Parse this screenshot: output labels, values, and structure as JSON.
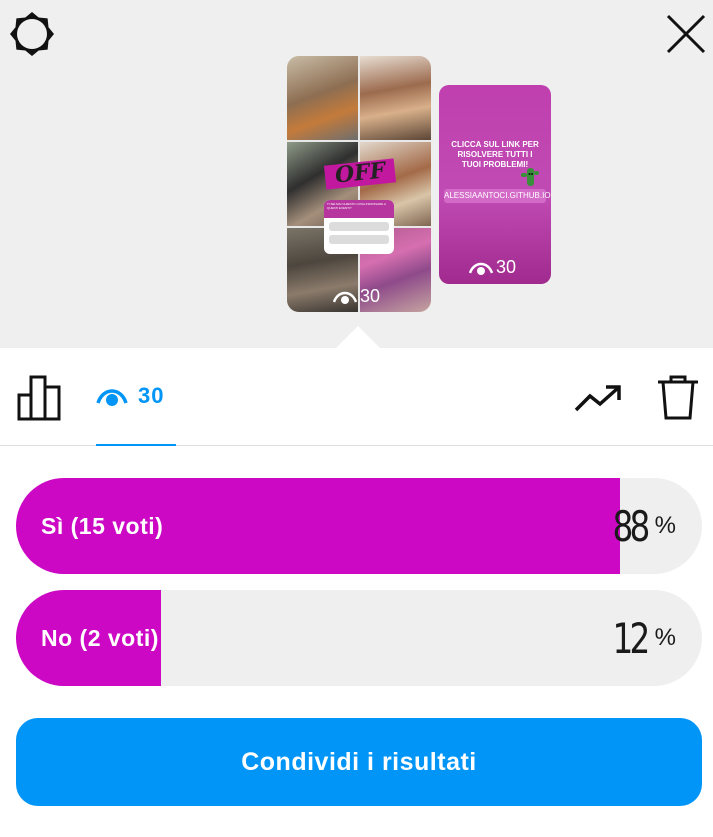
{
  "header": {
    "settings_icon": "settings-icon",
    "close_icon": "close-icon"
  },
  "stories": {
    "current": {
      "views": "30",
      "sticker_text": "OFF",
      "poll_sticker_question": "TI SEI MAI CHIESTO COSA INDOSSARE A QUESTI EVENTI?"
    },
    "next": {
      "text": "CLICCA SUL LINK PER RISOLVERE TUTTI I TUOI PROBLEMI!",
      "link": "ALESSIAANTOCI.GITHUB.IO",
      "views": "30"
    }
  },
  "tabs": {
    "views_count": "30",
    "active": "views"
  },
  "poll": {
    "options": [
      {
        "label": "Sì (15 voti)",
        "percent_num": "88",
        "percent_sym": "%",
        "fraction": 0.88
      },
      {
        "label": "No (2 voti)",
        "percent_num": "12",
        "percent_sym": "%",
        "fraction": 0.12
      }
    ],
    "fill_color": "#cc08c4"
  },
  "actions": {
    "share_label": "Condividi i risultati"
  },
  "colors": {
    "accent": "#0095f6",
    "poll_fill": "#cc08c4",
    "background": "#efefef"
  }
}
